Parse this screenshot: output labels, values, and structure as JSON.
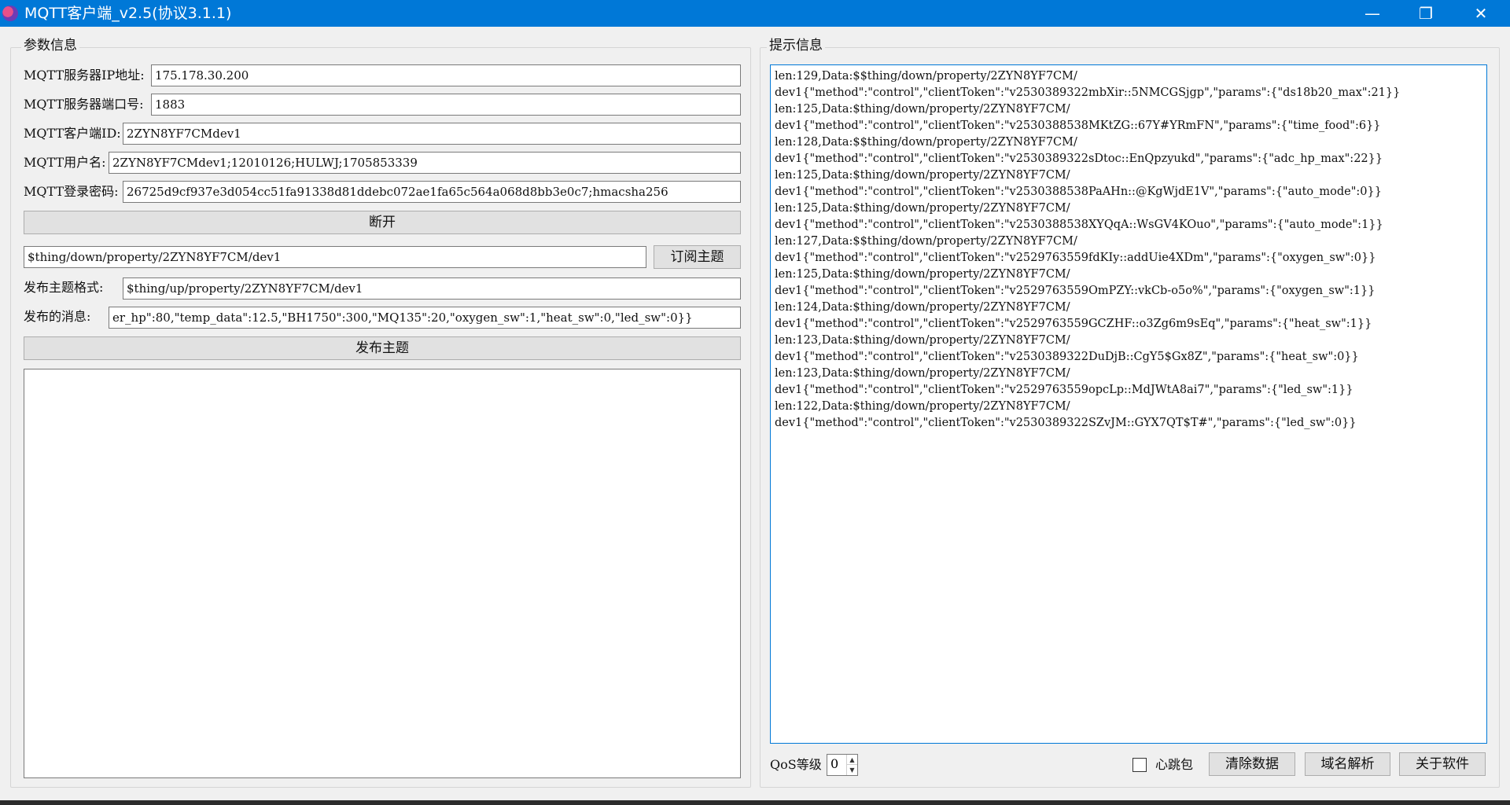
{
  "window": {
    "title": "MQTT客户端_v2.5(协议3.1.1)",
    "minimize": "—",
    "maximize": "❐",
    "close": "✕"
  },
  "params": {
    "group_title": "参数信息",
    "ip_label": "MQTT服务器IP地址:",
    "ip_value": "175.178.30.200",
    "port_label": "MQTT服务器端口号:",
    "port_value": "1883",
    "client_id_label": "MQTT客户端ID:",
    "client_id_value": "2ZYN8YF7CMdev1",
    "username_label": "MQTT用户名:",
    "username_value": "2ZYN8YF7CMdev1;12010126;HULWJ;1705853339",
    "password_label": "MQTT登录密码:",
    "password_value": "26725d9cf937e3d054cc51fa91338d81ddebc072ae1fa65c564a068d8bb3e0c7;hmacsha256",
    "disconnect_label": "断开",
    "subscribe_topic_value": "$thing/down/property/2ZYN8YF7CM/dev1",
    "subscribe_label": "订阅主题",
    "publish_format_label": "发布主题格式:",
    "publish_format_value": "$thing/up/property/2ZYN8YF7CM/dev1",
    "publish_message_label": "发布的消息:",
    "publish_message_value": "er_hp\":80,\"temp_data\":12.5,\"BH1750\":300,\"MQ135\":20,\"oxygen_sw\":1,\"heat_sw\":0,\"led_sw\":0}}",
    "publish_label": "发布主题"
  },
  "info": {
    "group_title": "提示信息",
    "log": [
      "len:129,Data:$$thing/down/property/2ZYN8YF7CM/",
      "dev1{\"method\":\"control\",\"clientToken\":\"v2530389322mbXir::5NMCGSjgp\",\"params\":{\"ds18b20_max\":21}}",
      "len:125,Data:$thing/down/property/2ZYN8YF7CM/",
      "dev1{\"method\":\"control\",\"clientToken\":\"v2530388538MKtZG::67Y#YRmFN\",\"params\":{\"time_food\":6}}",
      "len:128,Data:$$thing/down/property/2ZYN8YF7CM/",
      "dev1{\"method\":\"control\",\"clientToken\":\"v2530389322sDtoc::EnQpzyukd\",\"params\":{\"adc_hp_max\":22}}",
      "len:125,Data:$thing/down/property/2ZYN8YF7CM/",
      "dev1{\"method\":\"control\",\"clientToken\":\"v2530388538PaAHn::@KgWjdE1V\",\"params\":{\"auto_mode\":0}}",
      "len:125,Data:$thing/down/property/2ZYN8YF7CM/",
      "dev1{\"method\":\"control\",\"clientToken\":\"v2530388538XYQqA::WsGV4KOuo\",\"params\":{\"auto_mode\":1}}",
      "len:127,Data:$$thing/down/property/2ZYN8YF7CM/",
      "dev1{\"method\":\"control\",\"clientToken\":\"v2529763559fdKIy::addUie4XDm\",\"params\":{\"oxygen_sw\":0}}",
      "len:125,Data:$thing/down/property/2ZYN8YF7CM/",
      "dev1{\"method\":\"control\",\"clientToken\":\"v2529763559OmPZY::vkCb-o5o%\",\"params\":{\"oxygen_sw\":1}}",
      "len:124,Data:$thing/down/property/2ZYN8YF7CM/",
      "dev1{\"method\":\"control\",\"clientToken\":\"v2529763559GCZHF::o3Zg6m9sEq\",\"params\":{\"heat_sw\":1}}",
      "len:123,Data:$thing/down/property/2ZYN8YF7CM/",
      "dev1{\"method\":\"control\",\"clientToken\":\"v2530389322DuDjB::CgY5$Gx8Z\",\"params\":{\"heat_sw\":0}}",
      "len:123,Data:$thing/down/property/2ZYN8YF7CM/",
      "dev1{\"method\":\"control\",\"clientToken\":\"v2529763559opcLp::MdJWtA8ai7\",\"params\":{\"led_sw\":1}}",
      "len:122,Data:$thing/down/property/2ZYN8YF7CM/",
      "dev1{\"method\":\"control\",\"clientToken\":\"v2530389322SZvJM::GYX7QT$T#\",\"params\":{\"led_sw\":0}}"
    ],
    "qos_label": "QoS等级",
    "qos_value": "0",
    "heartbeat_label": "心跳包",
    "clear_label": "清除数据",
    "dns_label": "域名解析",
    "about_label": "关于软件"
  }
}
